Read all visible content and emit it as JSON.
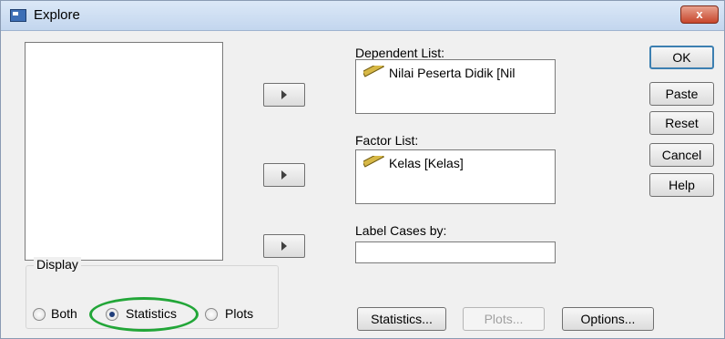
{
  "window": {
    "title": "Explore",
    "close_label": "x"
  },
  "lists": {
    "dependent_label": "Dependent List:",
    "dependent_item": "Nilai Peserta Didik [Nil",
    "factor_label": "Factor List:",
    "factor_item": "Kelas [Kelas]",
    "label_cases_label": "Label Cases by:",
    "label_cases_value": ""
  },
  "side_buttons": {
    "ok": "OK",
    "paste": "Paste",
    "reset": "Reset",
    "cancel": "Cancel",
    "help": "Help"
  },
  "display": {
    "legend": "Display",
    "options": [
      "Both",
      "Statistics",
      "Plots"
    ],
    "selected": "Statistics"
  },
  "bottom_buttons": {
    "statistics": "Statistics...",
    "plots": "Plots...",
    "options": "Options..."
  },
  "icons": {
    "variable": "ruler-icon",
    "move": "right-arrow-icon"
  },
  "colors": {
    "highlight": "#22a638",
    "titlebar": "#c3d6ee",
    "close": "#c7462c"
  }
}
